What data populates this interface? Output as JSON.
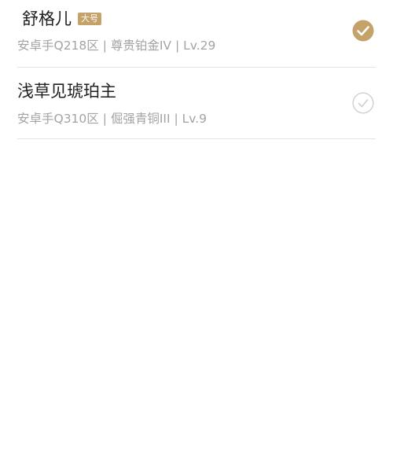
{
  "accounts": [
    {
      "name": "舒格儿",
      "badge": "大号",
      "subtitle": "安卓手Q218区 | 尊贵铂金IV | Lv.29",
      "selected": true
    },
    {
      "name": "浅草见琥珀主",
      "subtitle": "安卓手Q310区 | 倔强青铜III | Lv.9",
      "selected": false
    }
  ],
  "colors": {
    "check_selected": "#c4a26a",
    "check_unselected": "#cfcfcf",
    "badge_bg": "#c4a26a"
  },
  "icons": {
    "selected": "check-circle-filled-icon",
    "unselected": "check-circle-outline-icon"
  }
}
